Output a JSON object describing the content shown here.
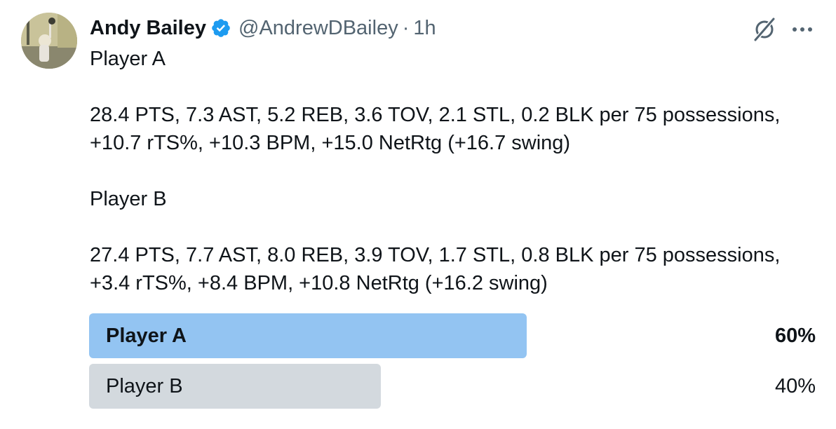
{
  "author": {
    "display_name": "Andy Bailey",
    "verified": true,
    "handle": "@AndrewDBailey",
    "separator": "·",
    "time": "1h"
  },
  "icons": {
    "avatar": "profile-photo",
    "verified": "verified-badge-icon",
    "grok": "grok-icon",
    "more": "more-icon"
  },
  "body": {
    "lines": [
      "Player A",
      "",
      "28.4 PTS, 7.3 AST, 5.2 REB, 3.6 TOV, 2.1 STL, 0.2 BLK per 75 possessions,",
      "+10.7 rTS%, +10.3 BPM, +15.0 NetRtg (+16.7 swing)",
      "",
      "Player B",
      "",
      "27.4 PTS, 7.7 AST, 8.0 REB, 3.9 TOV, 1.7 STL, 0.8 BLK per 75 possessions,",
      "+3.4 rTS%, +8.4 BPM, +10.8 NetRtg (+16.2 swing)"
    ]
  },
  "poll": {
    "options": [
      {
        "label": "Player A",
        "percent_text": "60%",
        "fraction": 0.6,
        "winner": true,
        "color": "#93c4f2"
      },
      {
        "label": "Player B",
        "percent_text": "40%",
        "fraction": 0.4,
        "winner": false,
        "color": "#d3d9de"
      }
    ]
  },
  "colors": {
    "verified_badge": "#1d9bf0",
    "muted_text": "#536471",
    "primary_text": "#0f1419"
  }
}
